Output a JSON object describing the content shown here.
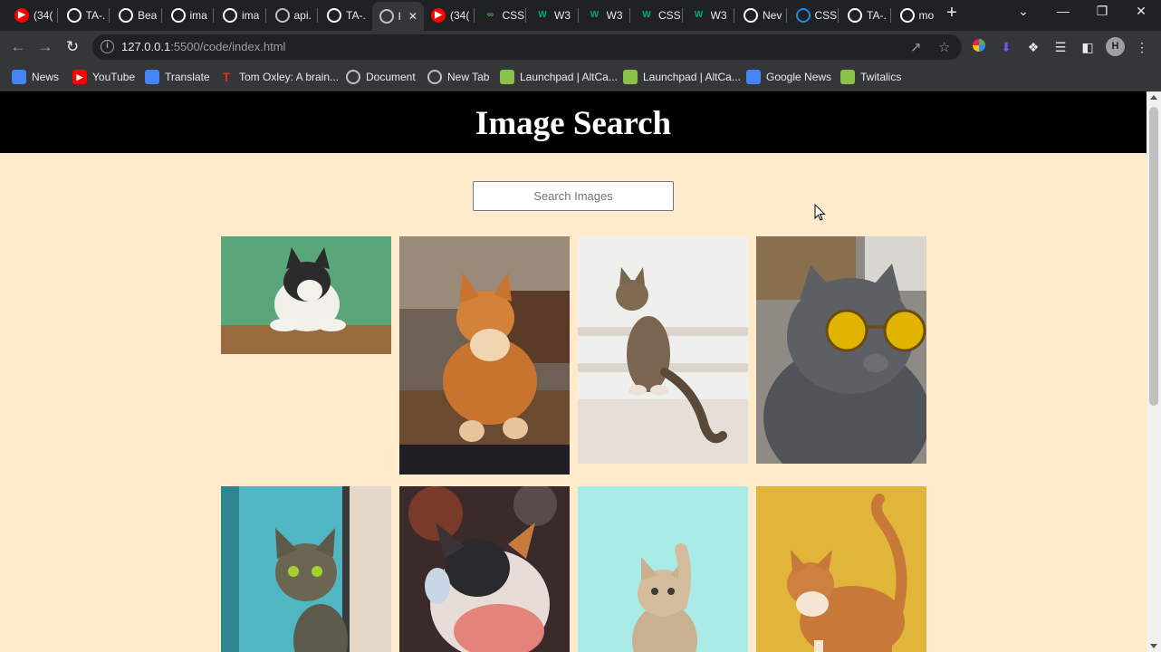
{
  "browser": {
    "tabs": [
      {
        "title": "(34(",
        "icon": "youtube-icon",
        "color": "#ff0000"
      },
      {
        "title": "TA-.",
        "icon": "github-icon",
        "color": "#ffffff"
      },
      {
        "title": "Bea",
        "icon": "document-icon",
        "color": "#ffffff"
      },
      {
        "title": "ima",
        "icon": "document-icon",
        "color": "#ffffff"
      },
      {
        "title": "ima",
        "icon": "document-icon",
        "color": "#ffffff"
      },
      {
        "title": "api.",
        "icon": "globe-icon",
        "color": "#bdc1c6"
      },
      {
        "title": "TA-.",
        "icon": "github-icon",
        "color": "#ffffff"
      },
      {
        "title": "I",
        "icon": "globe-icon",
        "color": "#bdc1c6",
        "active": true
      },
      {
        "title": "(34(",
        "icon": "youtube-icon",
        "color": "#ff0000"
      },
      {
        "title": "CSS",
        "icon": "css-icon",
        "color": "#4caf50"
      },
      {
        "title": "W3",
        "icon": "w3schools-icon",
        "color": "#04aa6d"
      },
      {
        "title": "W3",
        "icon": "w3schools-icon",
        "color": "#04aa6d"
      },
      {
        "title": "CSS",
        "icon": "w3schools-icon",
        "color": "#04aa6d"
      },
      {
        "title": "W3",
        "icon": "w3schools-icon",
        "color": "#04aa6d"
      },
      {
        "title": "Nev",
        "icon": "globe-icon",
        "color": "#ffffff"
      },
      {
        "title": "CSS",
        "icon": "loading-icon",
        "color": "#1e88e5"
      },
      {
        "title": "TA-.",
        "icon": "github-icon",
        "color": "#ffffff"
      },
      {
        "title": "mo",
        "icon": "google-icon",
        "color": "#ffffff"
      }
    ],
    "url": {
      "host": "127.0.0.1",
      "path": ":5500/code/index.html"
    },
    "avatar_letter": "H",
    "bookmarks": [
      {
        "label": "News",
        "icon": "google-news-icon",
        "color": "#4285f4"
      },
      {
        "label": "YouTube",
        "icon": "youtube-icon",
        "color": "#ff0000"
      },
      {
        "label": "Translate",
        "icon": "google-translate-icon",
        "color": "#4285f4"
      },
      {
        "label": "Tom Oxley: A brain...",
        "icon": "ted-icon",
        "color": "#e62b1e"
      },
      {
        "label": "Document",
        "icon": "globe-icon",
        "color": "#bdc1c6"
      },
      {
        "label": "New Tab",
        "icon": "globe-icon",
        "color": "#bdc1c6"
      },
      {
        "label": "Launchpad | AltCa...",
        "icon": "chart-icon",
        "color": "#8bc34a"
      },
      {
        "label": "Launchpad | AltCa...",
        "icon": "chart-icon",
        "color": "#8bc34a"
      },
      {
        "label": "Google News",
        "icon": "google-news-icon",
        "color": "#4285f4"
      },
      {
        "label": "Twitalics",
        "icon": "twitalics-icon",
        "color": "#8bc34a"
      }
    ]
  },
  "page": {
    "title": "Image Search",
    "search_placeholder": "Search Images",
    "background": "#ffebcc",
    "header_background": "#000000",
    "images": [
      {
        "name": "cat-green-background",
        "bg": "#5aa67a",
        "cat": "#2f2f2f"
      },
      {
        "name": "cat-orange-fluffy",
        "bg": "#8a7766",
        "cat": "#c8742f"
      },
      {
        "name": "cat-tabby-stairs",
        "bg": "#ececec",
        "cat": "#7a6650"
      },
      {
        "name": "cat-grey-sunglasses",
        "bg": "#8f8a84",
        "cat": "#5c5f63"
      },
      {
        "name": "cat-tabby-turquoise-door",
        "bg": "#4fb6c2",
        "cat": "#5c5a4a"
      },
      {
        "name": "cat-calico-red",
        "bg": "#3b2a2a",
        "cat": "#e8dcd8"
      },
      {
        "name": "cat-kitten-paw",
        "bg": "#a9ebe6",
        "cat": "#c9b090"
      },
      {
        "name": "cat-orange-yellow",
        "bg": "#e1b53a",
        "cat": "#c8793a"
      }
    ]
  }
}
